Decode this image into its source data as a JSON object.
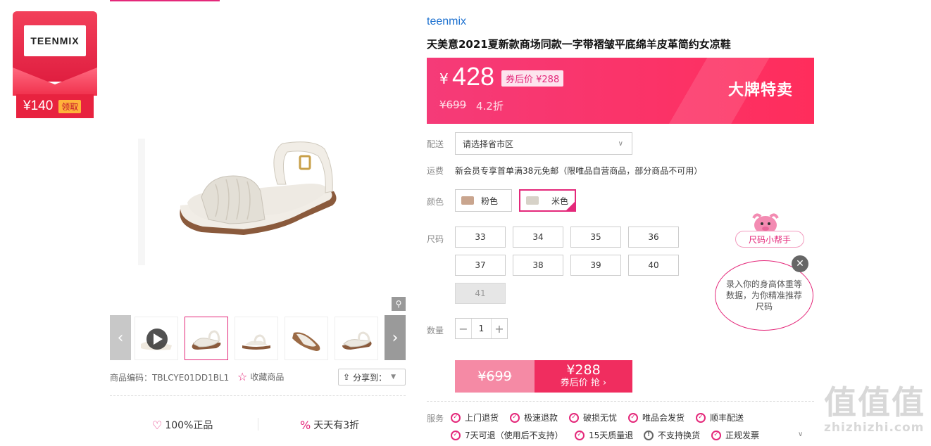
{
  "coupon_badge": {
    "brand_logo_text": "TEENMIX",
    "amount": "¥140",
    "action": "领取"
  },
  "gallery": {
    "zoom_icon": "magnifier-icon",
    "thumbnails": [
      "video-thumb",
      "white-sandal-side",
      "white-sandal-front",
      "sandal-sole",
      "white-sandal-angle"
    ]
  },
  "product": {
    "brand": "teenmix",
    "title": "天美意2021夏新款商场同款一字带褶皱平底绵羊皮革简约女凉鞋",
    "sku_label": "商品编码：TBLCYE01DD1BL1",
    "favorite_label": "收藏商品",
    "share_label": "分享到："
  },
  "guarantees": [
    {
      "icon": "shield-icon",
      "label": "100%正品"
    },
    {
      "icon": "discount-icon",
      "label": "天天有3折"
    }
  ],
  "price": {
    "yen": "¥",
    "current": "428",
    "coupon_tag": "券后价 ¥288",
    "original": "¥699",
    "discount": "4.2折",
    "promo": "大牌特卖"
  },
  "shipping": {
    "label": "配送",
    "region_placeholder": "请选择省市区"
  },
  "fee": {
    "label": "运费",
    "text": "新会员专享首单满38元免邮（限唯品自营商品，部分商品不可用）"
  },
  "colors": {
    "label": "颜色",
    "options": [
      {
        "name": "粉色",
        "swatch": "#c9a58e",
        "selected": false
      },
      {
        "name": "米色",
        "swatch": "#d7d2c8",
        "selected": true
      }
    ]
  },
  "sizes": {
    "label": "尺码",
    "options": [
      "33",
      "34",
      "35",
      "36",
      "37",
      "38",
      "39",
      "40",
      "41"
    ],
    "disabled": [
      "41"
    ]
  },
  "quantity": {
    "label": "数量",
    "value": "1",
    "minus": "−",
    "plus": "+"
  },
  "buy": {
    "original": "¥699",
    "coupon_price": "¥288",
    "coupon_action": "券后价 抢 ›"
  },
  "services": {
    "label": "服务",
    "items": [
      {
        "text": "上门退货",
        "ok": true
      },
      {
        "text": "极速退款",
        "ok": true
      },
      {
        "text": "破损无忧",
        "ok": true
      },
      {
        "text": "唯品会发货",
        "ok": true
      },
      {
        "text": "顺丰配送",
        "ok": true
      },
      {
        "text": "7天可退（使用后不支持）",
        "ok": true
      },
      {
        "text": "15天质量退",
        "ok": true
      },
      {
        "text": "不支持换货",
        "ok": false
      },
      {
        "text": "正规发票",
        "ok": true
      }
    ],
    "more_icon": "chevron-down-icon"
  },
  "size_helper": {
    "tag": "尺码小帮手",
    "bubble": "录入你的身高体重等数据，为你精准推荐尺码",
    "close": "✕"
  },
  "watermark": {
    "big": "值值值",
    "small": "zhizhizhi.com"
  },
  "colors_theme": {
    "accent": "#e4287a",
    "price_bg": "#ff2d5c",
    "link": "#1a6fcf"
  }
}
